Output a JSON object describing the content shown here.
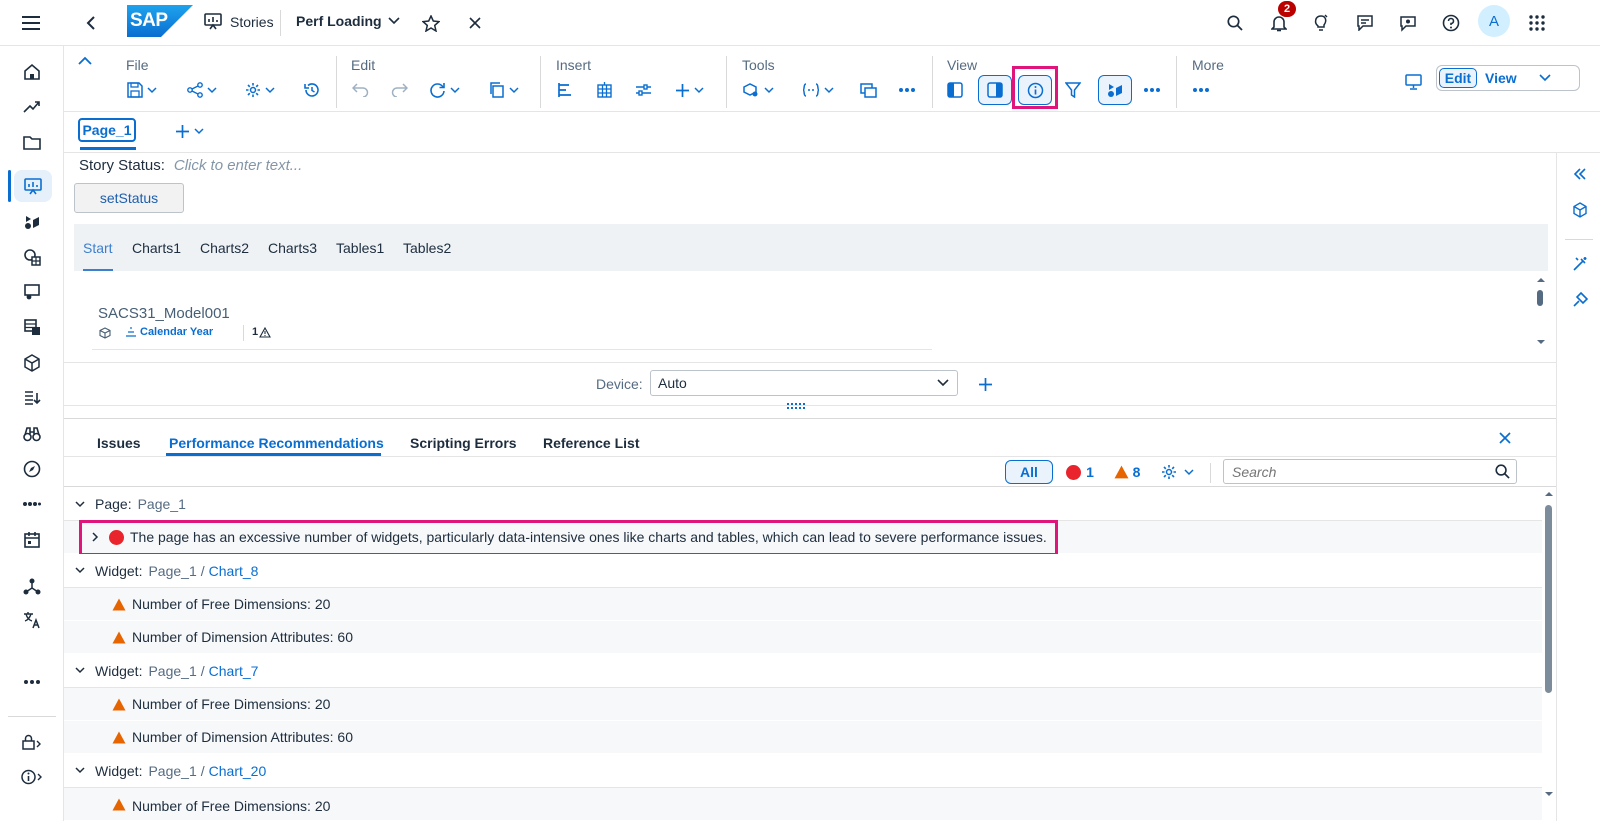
{
  "shell": {
    "logo_text": "SAP",
    "app_name": "Stories",
    "story_title": "Perf Loading",
    "notification_count": "2",
    "avatar_initial": "A"
  },
  "toolbar": {
    "groups": {
      "file": "File",
      "edit": "Edit",
      "insert": "Insert",
      "tools": "Tools",
      "view": "View",
      "more": "More"
    },
    "mode_edit": "Edit",
    "mode_view": "View",
    "highlight_color": "#e0157c"
  },
  "page_tabs": {
    "active": "Page_1"
  },
  "canvas": {
    "story_status_label": "Story Status:",
    "story_status_placeholder": "Click to enter text...",
    "set_status_button": "setStatus",
    "tabs": [
      "Start",
      "Charts1",
      "Charts2",
      "Charts3",
      "Tables1",
      "Tables2"
    ],
    "model_name": "SACS31_Model001",
    "model_filter": "Calendar Year",
    "model_warning_count": "1",
    "device_label": "Device:",
    "device_value": "Auto"
  },
  "bottom_panel": {
    "tabs": [
      "Issues",
      "Performance Recommendations",
      "Scripting Errors",
      "Reference List"
    ],
    "active_tab": "Performance Recommendations",
    "filter_all": "All",
    "error_count": "1",
    "warning_count": "8",
    "search_placeholder": "Search",
    "rows": {
      "g1_label": "Page:",
      "g1_value": "Page_1",
      "e1_text": "The page has an excessive number of widgets, particularly data-intensive ones like charts and tables, which can lead to severe performance issues.",
      "g2_label": "Widget:",
      "g2_page": "Page_1",
      "g2_sep": "/",
      "g2_widget": "Chart_8",
      "w1_text": "Number of Free Dimensions: 20",
      "w2_text": "Number of Dimension Attributes: 60",
      "g3_label": "Widget:",
      "g3_page": "Page_1",
      "g3_sep": "/",
      "g3_widget": "Chart_7",
      "w3_text": "Number of Free Dimensions: 20",
      "w4_text": "Number of Dimension Attributes: 60",
      "g4_label": "Widget:",
      "g4_page": "Page_1",
      "g4_sep": "/",
      "g4_widget": "Chart_20",
      "w5_text": "Number of Free Dimensions: 20"
    }
  },
  "colors": {
    "accent": "#0a6ed1",
    "error": "#e9242d",
    "warning": "#e76500",
    "highlight": "#e0157c"
  }
}
